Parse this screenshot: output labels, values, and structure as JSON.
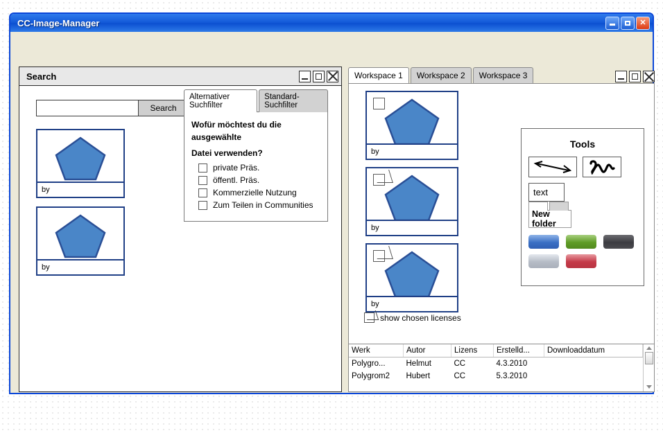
{
  "app": {
    "title": "CC-Image-Manager",
    "controls": {
      "minimize": "_",
      "maximize": "□",
      "close": "✕"
    }
  },
  "search_panel": {
    "title": "Search",
    "input_value": "",
    "input_placeholder": "",
    "button_label": "Search",
    "thumbnails": [
      {
        "caption": "by"
      },
      {
        "caption": "by"
      }
    ],
    "filter": {
      "tabs": [
        {
          "label": "Alternativer Suchfilter",
          "active": true
        },
        {
          "label": "Standard- Suchfilter",
          "active": false
        }
      ],
      "question_line1": "Wofür möchtest du die ausgewählte",
      "question_line2": "Datei verwenden?",
      "options": [
        {
          "label": "private Präs.",
          "checked": false
        },
        {
          "label": "öffentl. Präs.",
          "checked": false
        },
        {
          "label": "Kommerzielle Nutzung",
          "checked": false
        },
        {
          "label": "Zum Teilen in Communities",
          "checked": false
        }
      ]
    }
  },
  "workspace_panel": {
    "tabs": [
      {
        "label": "Workspace 1",
        "active": true
      },
      {
        "label": "Workspace 2",
        "active": false
      },
      {
        "label": "Workspace 3",
        "active": false
      }
    ],
    "thumbnails": [
      {
        "caption": "by",
        "selected": false
      },
      {
        "caption": "by",
        "selected": true
      },
      {
        "caption": "by",
        "selected": true
      }
    ],
    "show_licenses": {
      "label": "show chosen licenses",
      "checked": true
    },
    "tools": {
      "title": "Tools",
      "arrow_tool": "↔",
      "squiggle_tool": "∿",
      "text_tool": "text",
      "folder": {
        "tab1": "",
        "tab2": "",
        "label": "New folder"
      },
      "swatches": [
        {
          "name": "blue",
          "color": "#4a7fd4"
        },
        {
          "name": "green",
          "color": "#6aa832"
        },
        {
          "name": "dark",
          "color": "#4a4a4e"
        },
        {
          "name": "silver",
          "color": "#c3c8d0"
        },
        {
          "name": "red",
          "color": "#cf4a55"
        }
      ]
    },
    "table": {
      "columns": [
        "Werk",
        "Autor",
        "Lizens",
        "Erstelld...",
        "Downloaddatum"
      ],
      "rows": [
        [
          "Polygro...",
          "Helmut",
          "CC",
          "4.3.2010",
          ""
        ],
        [
          "Polygrom2",
          "Hubert",
          "CC",
          "5.3.2010",
          ""
        ]
      ]
    }
  }
}
